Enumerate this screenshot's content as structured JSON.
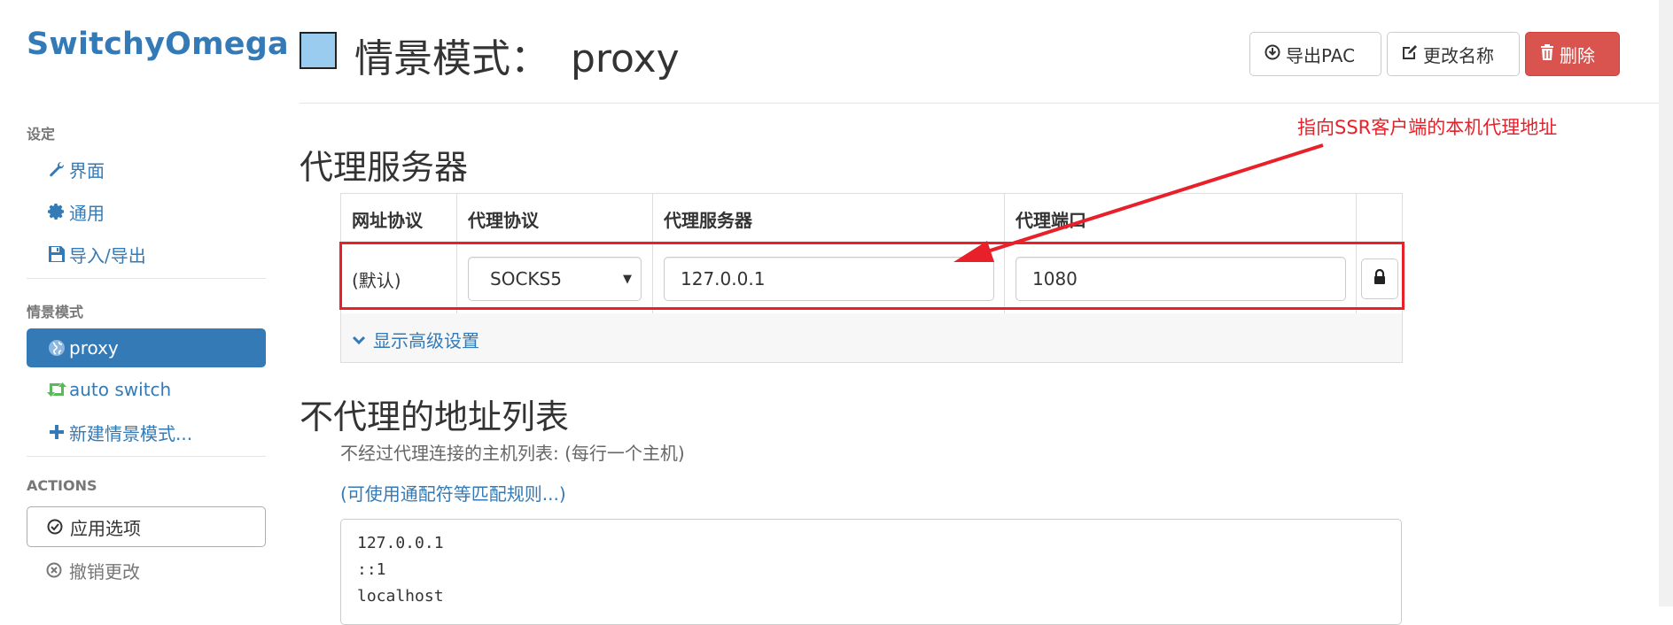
{
  "brand": "SwitchyOmega",
  "sidebar": {
    "settings_header": "设定",
    "settings_items": [
      {
        "label": "界面",
        "icon": "wrench-icon"
      },
      {
        "label": "通用",
        "icon": "gear-icon"
      },
      {
        "label": "导入/导出",
        "icon": "floppy-icon"
      }
    ],
    "profiles_header": "情景模式",
    "profile_items": [
      {
        "label": "proxy",
        "icon": "globe-icon",
        "active": true
      },
      {
        "label": "auto switch",
        "icon": "retweet-icon"
      },
      {
        "label": "新建情景模式...",
        "icon": "plus-icon"
      }
    ],
    "actions_header": "ACTIONS",
    "apply_label": "应用选项",
    "discard_label": "撤销更改"
  },
  "header": {
    "title_prefix": "情景模式：",
    "profile_name": "proxy",
    "profile_color": "#99ccee",
    "export_pac_label": "导出PAC",
    "rename_label": "更改名称",
    "delete_label": "删除"
  },
  "proxy_section": {
    "title": "代理服务器",
    "columns": [
      "网址协议",
      "代理协议",
      "代理服务器",
      "代理端口"
    ],
    "row": {
      "scheme": "(默认)",
      "protocol": "SOCKS5",
      "server": "127.0.0.1",
      "port": "1080"
    },
    "advanced_label": "显示高级设置"
  },
  "annotation": "指向SSR客户端的本机代理地址",
  "bypass_section": {
    "title": "不代理的地址列表",
    "help_text": "不经过代理连接的主机列表: (每行一个主机)",
    "help_link": "(可使用通配符等匹配规则...)",
    "lines": [
      "127.0.0.1",
      "::1",
      "localhost"
    ]
  },
  "colors": {
    "accent": "#337ab7",
    "danger": "#d9534f",
    "annotation": "#e8202a"
  }
}
